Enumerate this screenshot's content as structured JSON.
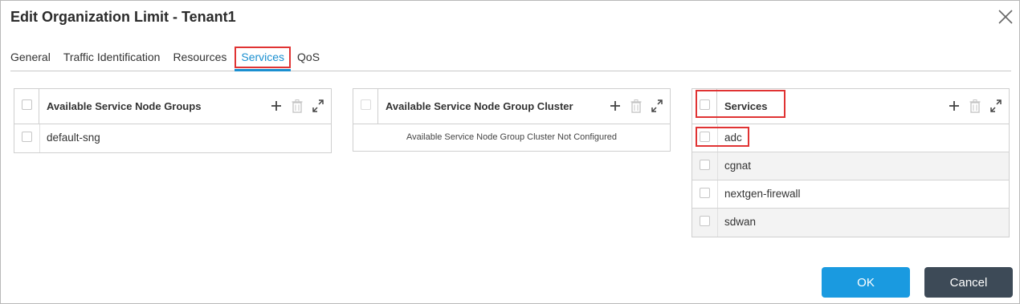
{
  "dialog": {
    "title": "Edit Organization Limit - Tenant1"
  },
  "tabs": [
    {
      "label": "General"
    },
    {
      "label": "Traffic Identification"
    },
    {
      "label": "Resources"
    },
    {
      "label": "Services",
      "active": true
    },
    {
      "label": "QoS"
    }
  ],
  "panels": {
    "sng": {
      "title": "Available Service Node Groups",
      "rows": [
        {
          "label": "default-sng"
        }
      ]
    },
    "sngc": {
      "title": "Available Service Node Group Cluster",
      "empty_message": "Available Service Node Group Cluster Not Configured"
    },
    "services": {
      "title": "Services",
      "rows": [
        {
          "label": "adc"
        },
        {
          "label": "cgnat"
        },
        {
          "label": "nextgen-firewall"
        },
        {
          "label": "sdwan"
        }
      ]
    }
  },
  "icons": {
    "add": "plus-icon",
    "delete": "trash-icon",
    "expand": "expand-icon",
    "close": "close-icon"
  },
  "buttons": {
    "ok_label": "OK",
    "cancel_label": "Cancel"
  },
  "colors": {
    "accent": "#1a9ae0",
    "active_tab": "#1a8fd0",
    "highlight": "#e03333",
    "cancel_bg": "#3d4a57"
  }
}
